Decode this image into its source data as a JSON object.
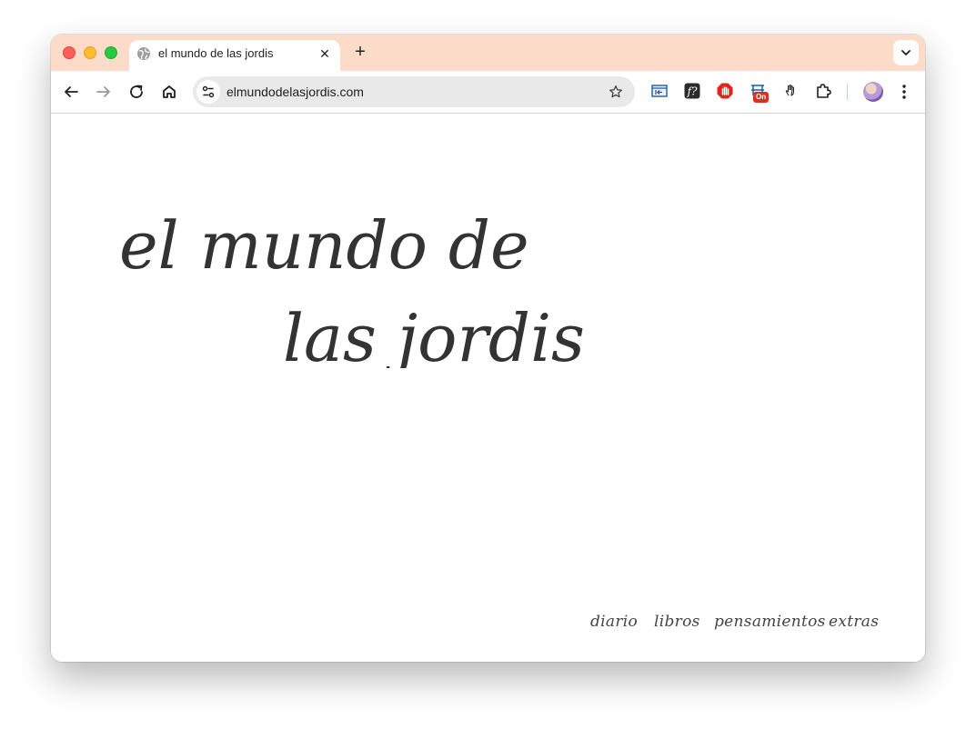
{
  "browser": {
    "tab": {
      "title": "el mundo de las jordis",
      "close_glyph": "✕"
    },
    "new_tab_glyph": "+",
    "address_bar": {
      "url": "elmundodelasjordis.com"
    },
    "extension_badge": "On",
    "icons": {
      "tab_favicon": "globe-icon",
      "back": "arrow-left-icon",
      "forward": "arrow-right-icon",
      "reload": "reload-icon",
      "home": "home-icon",
      "site_info": "tune-icon",
      "bookmark": "star-icon",
      "extensions": "puzzle-icon",
      "menu": "kebab-menu-icon"
    },
    "colors": {
      "tabstrip": "#fcdcc9",
      "omnibox": "#e9e9e9"
    }
  },
  "page": {
    "logo": {
      "line1": "el mundo de",
      "line2": "las jordis",
      "color": "#333333"
    },
    "nav": [
      {
        "label": "diario"
      },
      {
        "label": "libros"
      },
      {
        "label": "pensamientos"
      },
      {
        "label": "extras"
      }
    ]
  }
}
